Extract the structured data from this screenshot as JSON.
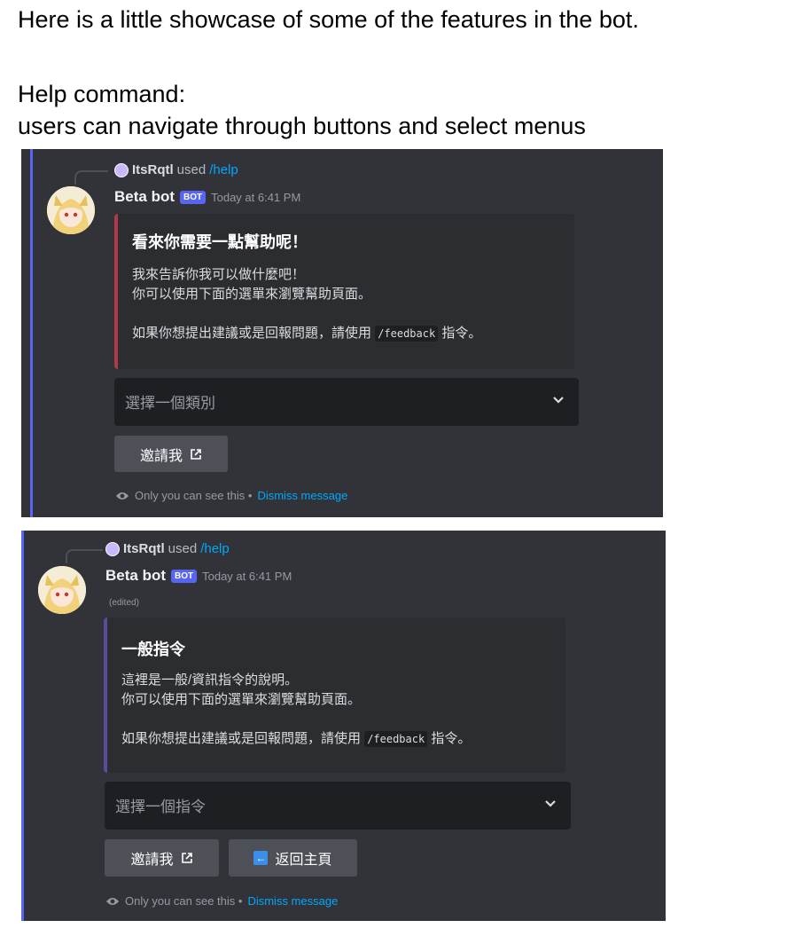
{
  "doc": {
    "intro": "Here is a little showcase of some of the features in the bot.",
    "section_title": "Help command:",
    "section_desc": "users can navigate through buttons and select menus"
  },
  "messages": [
    {
      "reply_user": "ItsRqtl",
      "reply_used": "used",
      "reply_command": "/help",
      "bot_name": "Beta bot",
      "badge": "BOT",
      "timestamp": "Today at 6:41 PM",
      "embed_color": "#b03a48",
      "embed_title": "看來你需要一點幫助呢！",
      "embed_line1": "我來告訴你我可以做什麼吧！",
      "embed_line2": "你可以使用下面的選單來瀏覽幫助頁面。",
      "embed_line3_pre": "如果你想提出建議或是回報問題，請使用",
      "embed_code": "/feedback",
      "embed_line3_post": "指令。",
      "select_placeholder": "選擇一個類別",
      "invite_label": "邀請我",
      "ephemeral": "Only you can see this •",
      "dismiss": "Dismiss message"
    },
    {
      "reply_user": "ItsRqtl",
      "reply_used": "used",
      "reply_command": "/help",
      "bot_name": "Beta bot",
      "badge": "BOT",
      "timestamp": "Today at 6:41 PM",
      "edited": "(edited)",
      "embed_color": "#5b4a9e",
      "embed_title": "一般指令",
      "embed_line1": "這裡是一般/資訊指令的說明。",
      "embed_line2": "你可以使用下面的選單來瀏覽幫助頁面。",
      "embed_line3_pre": "如果你想提出建議或是回報問題，請使用",
      "embed_code": "/feedback",
      "embed_line3_post": "指令。",
      "select_placeholder": "選擇一個指令",
      "invite_label": "邀請我",
      "back_label": "返回主頁",
      "ephemeral": "Only you can see this •",
      "dismiss": "Dismiss message"
    }
  ]
}
